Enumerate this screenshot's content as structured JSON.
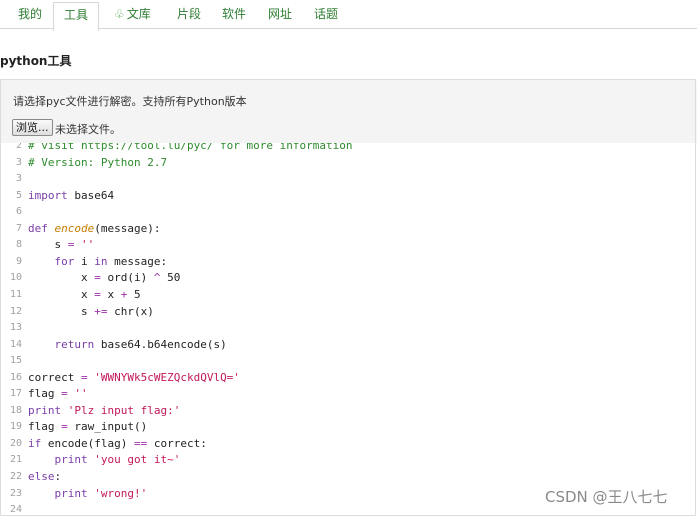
{
  "tabs": [
    {
      "id": "mine",
      "label": "我的",
      "active": false
    },
    {
      "id": "tools",
      "label": "工具",
      "active": true
    },
    {
      "id": "library",
      "label": "文库",
      "active": false,
      "icon": "leaf-icon"
    },
    {
      "id": "snippets",
      "label": "片段",
      "active": false
    },
    {
      "id": "software",
      "label": "软件",
      "active": false
    },
    {
      "id": "sites",
      "label": "网址",
      "active": false
    },
    {
      "id": "topics",
      "label": "话题",
      "active": false
    }
  ],
  "page_title": "python工具",
  "upload": {
    "description": "请选择pyc文件进行解密。支持所有Python版本",
    "browse_label": "浏览...",
    "file_status": "未选择文件。"
  },
  "code": {
    "lines": [
      {
        "n": "2",
        "text": "# visit https://tool.lu/pyc/ for more information"
      },
      {
        "n": "3",
        "text": "# Version: Python 2.7"
      },
      {
        "n": "3",
        "text": ""
      },
      {
        "n": "5",
        "text": "import base64"
      },
      {
        "n": "6",
        "text": ""
      },
      {
        "n": "7",
        "text": "def encode(message):"
      },
      {
        "n": "8",
        "text": "    s = ''"
      },
      {
        "n": "9",
        "text": "    for i in message:"
      },
      {
        "n": "10",
        "text": "        x = ord(i) ^ 50"
      },
      {
        "n": "11",
        "text": "        x = x + 5"
      },
      {
        "n": "12",
        "text": "        s += chr(x)"
      },
      {
        "n": "13",
        "text": ""
      },
      {
        "n": "14",
        "text": "    return base64.b64encode(s)"
      },
      {
        "n": "15",
        "text": ""
      },
      {
        "n": "16",
        "text": "correct = 'WWNYWk5cWEZQckdQVlQ='"
      },
      {
        "n": "17",
        "text": "flag = ''"
      },
      {
        "n": "18",
        "text": "print 'Plz input flag:'"
      },
      {
        "n": "19",
        "text": "flag = raw_input()"
      },
      {
        "n": "20",
        "text": "if encode(flag) == correct:"
      },
      {
        "n": "21",
        "text": "    print 'you got it~'"
      },
      {
        "n": "22",
        "text": "else:"
      },
      {
        "n": "23",
        "text": "    print 'wrong!'"
      },
      {
        "n": "24",
        "text": ""
      }
    ]
  },
  "watermark": "CSDN @王八七七",
  "colors": {
    "tab_text": "#2e7d32",
    "keyword": "#7a3ea8",
    "function": "#c77c00",
    "string": "#c2185b",
    "comment": "#2e8b2e",
    "line_number": "#a0a0a0"
  }
}
